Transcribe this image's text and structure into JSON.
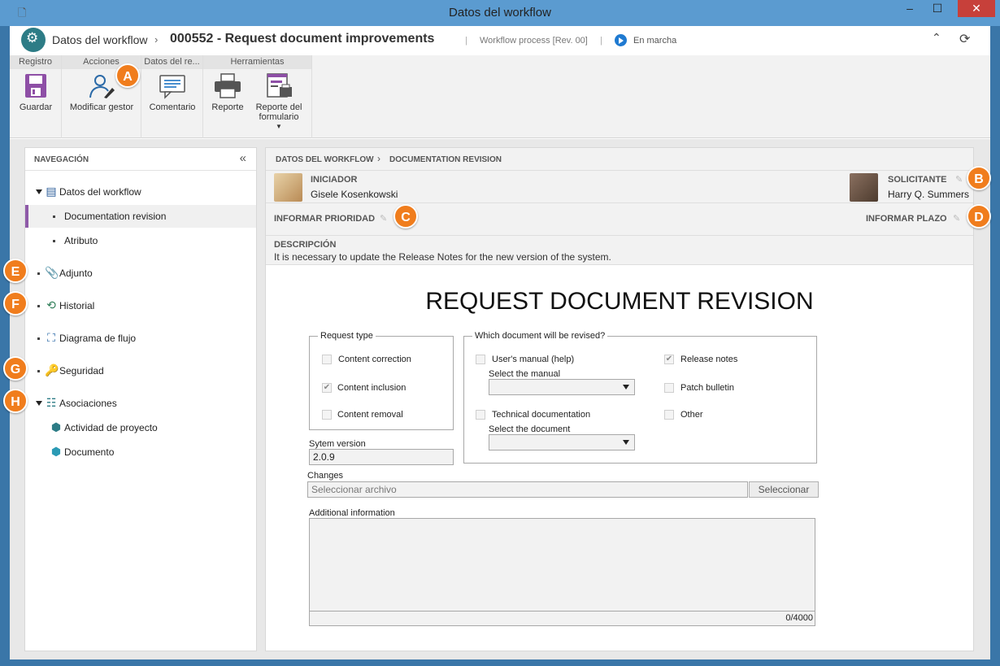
{
  "window": {
    "title": "Datos del workflow"
  },
  "header": {
    "section": "Datos del workflow",
    "record": "000552 - Request document improvements",
    "process": "Workflow process [Rev. 00]",
    "status": "En marcha"
  },
  "ribbon": {
    "groups": [
      "Registro",
      "Acciones",
      "Datos del re...",
      "Herramientas"
    ],
    "buttons": {
      "save": "Guardar",
      "change_manager": "Modificar gestor",
      "comment": "Comentario",
      "report": "Reporte",
      "form_report_1": "Reporte del",
      "form_report_2": "formulario"
    }
  },
  "navigation": {
    "title": "NAVEGACIÓN",
    "items": {
      "workflow_data": "Datos del workflow",
      "doc_revision": "Documentation revision",
      "attribute": "Atributo",
      "attachment": "Adjunto",
      "history": "Historial",
      "flowchart": "Diagrama de flujo",
      "security": "Seguridad",
      "associations": "Asociaciones",
      "project_activity": "Actividad de proyecto",
      "document": "Documento"
    }
  },
  "callouts": [
    "A",
    "B",
    "C",
    "D",
    "E",
    "F",
    "G",
    "H"
  ],
  "main": {
    "breadcrumb_1": "DATOS DEL WORKFLOW",
    "breadcrumb_2": "DOCUMENTATION REVISION",
    "initiator_label": "INICIADOR",
    "initiator_name": "Gisele Kosenkowski",
    "requester_label": "SOLICITANTE",
    "requester_name": "Harry Q. Summers",
    "priority_label": "INFORMAR PRIORIDAD",
    "deadline_label": "INFORMAR PLAZO",
    "description_label": "DESCRIPCIÓN",
    "description_text": "It is necessary to update the Release Notes for the new version of the system."
  },
  "form": {
    "title": "REQUEST DOCUMENT REVISION",
    "request_type": {
      "legend": "Request type",
      "options": [
        {
          "label": "Content correction",
          "checked": false
        },
        {
          "label": "Content inclusion",
          "checked": true
        },
        {
          "label": "Content removal",
          "checked": false
        }
      ]
    },
    "which_doc": {
      "legend": "Which document will be revised?",
      "users_manual": {
        "label": "User's manual (help)",
        "checked": false
      },
      "select_manual_label": "Select the manual",
      "technical_doc": {
        "label": "Technical documentation",
        "checked": false
      },
      "select_document_label": "Select the document",
      "release_notes": {
        "label": "Release notes",
        "checked": true
      },
      "patch_bulletin": {
        "label": "Patch bulletin",
        "checked": false
      },
      "other": {
        "label": "Other",
        "checked": false
      }
    },
    "system_version_label": "Sytem version",
    "system_version_value": "2.0.9",
    "changes_label": "Changes",
    "file_placeholder": "Seleccionar archivo",
    "select_button": "Seleccionar",
    "additional_info_label": "Additional information",
    "char_counter": "0/4000"
  },
  "colors": {
    "titlebar": "#5b9bd0",
    "close": "#c7403a",
    "callout": "#f07d1d",
    "nav_selected": "#8e5aa8",
    "status": "#1f7ad1"
  }
}
